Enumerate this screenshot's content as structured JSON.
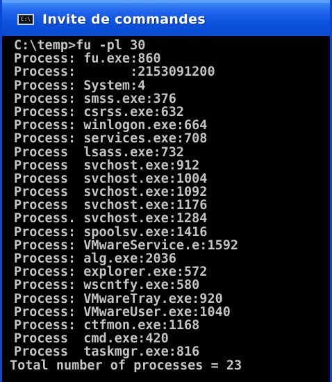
{
  "window": {
    "title": "Invite de commandes",
    "icon": "console-icon",
    "icon_text": "C:\\"
  },
  "console": {
    "lines": [
      "C:\\temp>fu -pl 30",
      "Process: fu.exe:860",
      "Process:       :2153091200",
      "Process: System:4",
      "Process: smss.exe:376",
      "Process: csrss.exe:632",
      "Process: winlogon.exe:664",
      "Process: services.exe:708",
      "Process  lsass.exe:732",
      "Process  svchost.exe:912",
      "Process  svchost.exe:1004",
      "Process  svchost.exe:1092",
      "Process  svchost.exe:1176",
      "Process. svchost.exe:1284",
      "Process: spoolsv.exe:1416",
      "Process: VMwareService.e:1592",
      "Process: alg.exe:2036",
      "Process: explorer.exe:572",
      "Process: wscntfy.exe:580",
      "Process: VMwareTray.exe:920",
      "Process: VMwareUser.exe:1040",
      "Process: ctfmon.exe:1168",
      "Process  cmd.exe:420",
      "Process  taskmgr.exe:816",
      "Total number of processes = 23"
    ]
  },
  "colors": {
    "titlebar": "#0a4bd1",
    "console_bg": "#000000",
    "console_text": "#c4c4c4"
  }
}
